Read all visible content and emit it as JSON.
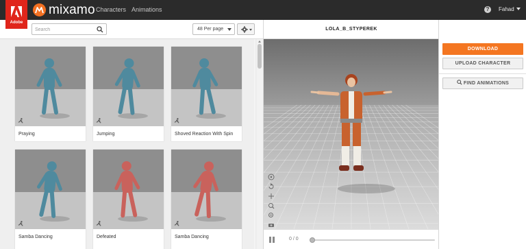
{
  "header": {
    "adobe_label": "Adobe",
    "brand": "mixamo",
    "nav": [
      "Characters",
      "Animations"
    ],
    "help_glyph": "?",
    "user": "Fahad"
  },
  "toolbar": {
    "search_placeholder": "Search",
    "per_page": "48 Per page"
  },
  "animations": [
    {
      "name": "Praying",
      "figure_color": "#4f8a9e"
    },
    {
      "name": "Jumping",
      "figure_color": "#4f8a9e"
    },
    {
      "name": "Shoved Reaction With Spin",
      "figure_color": "#4f8a9e"
    },
    {
      "name": "Samba Dancing",
      "figure_color": "#4f8a9e"
    },
    {
      "name": "Defeated",
      "figure_color": "#c9625c"
    },
    {
      "name": "Samba Dancing",
      "figure_color": "#c9625c"
    }
  ],
  "viewer": {
    "character_name": "LOLA_B_STYPEREK",
    "frame_counter": "0 / 0",
    "tools": [
      "gamepad-icon",
      "rotate-icon",
      "move-icon",
      "zoom-in-icon",
      "zoom-out-icon",
      "camera-icon"
    ]
  },
  "actions": {
    "download": "DOWNLOAD",
    "upload": "UPLOAD CHARACTER",
    "find": "FIND ANIMATIONS"
  },
  "colors": {
    "accent": "#f47621",
    "topbar": "#2b2b2b",
    "adobe_red": "#e0251b",
    "teal_figure": "#4f8a9e",
    "pink_figure": "#c9625c",
    "character_orange": "#c8622e"
  }
}
